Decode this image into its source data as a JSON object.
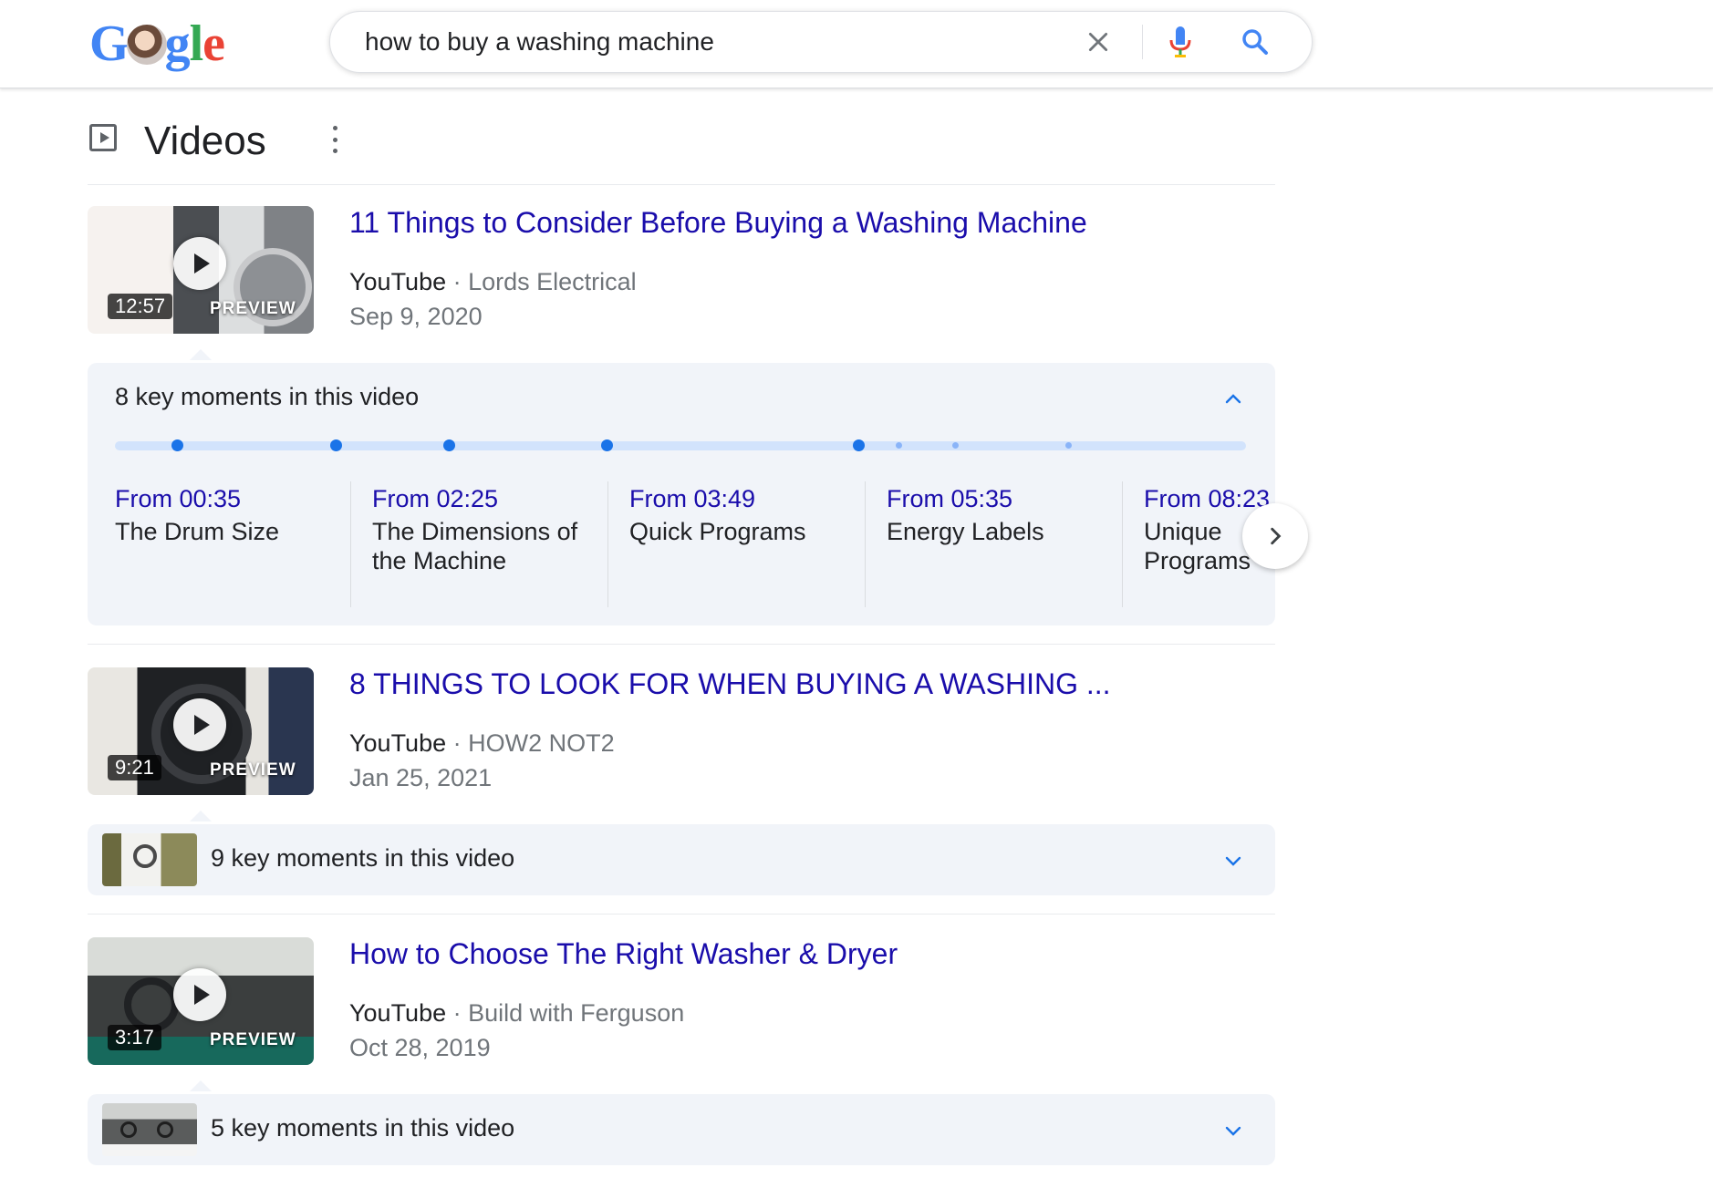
{
  "search": {
    "query": "how to buy a washing machine"
  },
  "section": {
    "title": "Videos"
  },
  "videos": [
    {
      "title": "11 Things to Consider Before Buying a Washing Machine",
      "source": "YouTube",
      "channel": "Lords Electrical",
      "date": "Sep 9, 2020",
      "duration": "12:57",
      "preview": "PREVIEW",
      "key_moments_label": "8 key moments in this video",
      "expanded": true,
      "moments": [
        {
          "time": "From 00:35",
          "label": "The Drum Size"
        },
        {
          "time": "From 02:25",
          "label": "The Dimensions of the Machine"
        },
        {
          "time": "From 03:49",
          "label": "Quick Programs"
        },
        {
          "time": "From 05:35",
          "label": "Energy Labels"
        },
        {
          "time": "From 08:23",
          "label": "Unique Programs"
        }
      ],
      "timeline_markers": [
        0.055,
        0.195,
        0.295,
        0.435,
        0.657
      ],
      "timeline_minor_markers": [
        0.693,
        0.743,
        0.843
      ]
    },
    {
      "title": "8 THINGS TO LOOK FOR WHEN BUYING A WASHING ...",
      "source": "YouTube",
      "channel": "HOW2 NOT2",
      "date": "Jan 25, 2021",
      "duration": "9:21",
      "preview": "PREVIEW",
      "key_moments_label": "9 key moments in this video",
      "expanded": false
    },
    {
      "title": "How to Choose The Right Washer & Dryer",
      "source": "YouTube",
      "channel": "Build with Ferguson",
      "date": "Oct 28, 2019",
      "duration": "3:17",
      "preview": "PREVIEW",
      "key_moments_label": "5 key moments in this video",
      "expanded": false
    }
  ],
  "colors": {
    "link": "#1a0dab",
    "accent": "#1a73e8",
    "panel": "#f1f4f9",
    "meta": "#70757a"
  }
}
